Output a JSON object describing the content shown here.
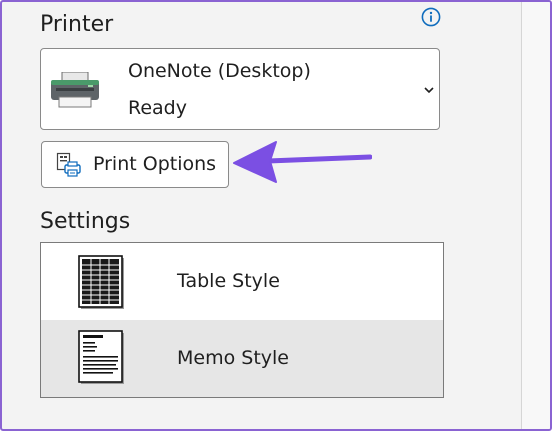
{
  "printer": {
    "heading": "Printer",
    "selected_name": "OneNote (Desktop)",
    "status": "Ready"
  },
  "print_options": {
    "label": "Print Options"
  },
  "settings": {
    "heading": "Settings",
    "styles": [
      {
        "label": "Table Style",
        "selected": false
      },
      {
        "label": "Memo Style",
        "selected": true
      }
    ]
  },
  "icons": {
    "info": "info-icon",
    "printer": "printer-icon",
    "dropdown": "chevron-down-icon",
    "print_options": "print-options-icon",
    "table_style": "table-style-icon",
    "memo_style": "memo-style-icon"
  },
  "colors": {
    "accent": "#7b4fe3",
    "info_blue": "#0f6cbd",
    "selected_row": "#e6e6e6",
    "frame_border": "#8a63d2"
  }
}
